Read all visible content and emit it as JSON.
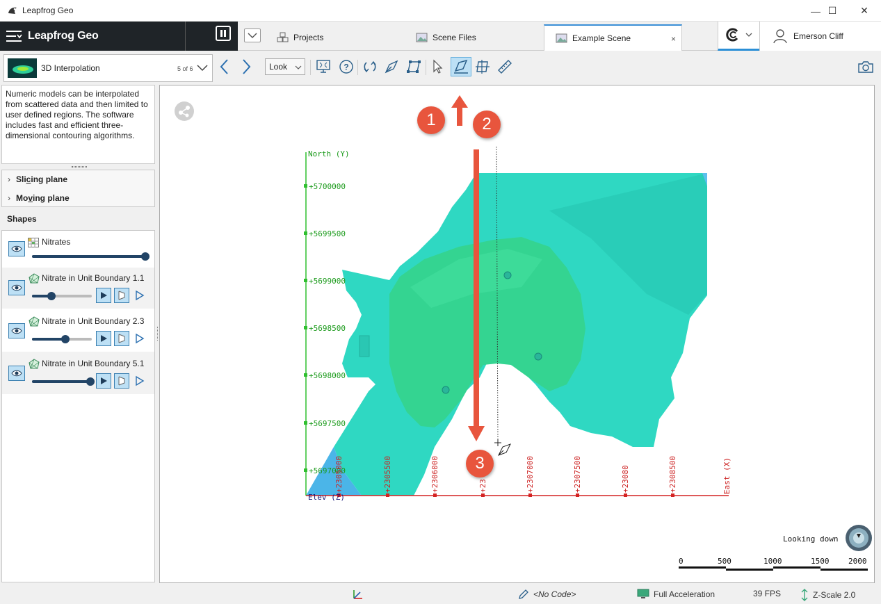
{
  "window": {
    "title": "Leapfrog Geo",
    "minimize": "—",
    "maximize": "☐",
    "close": "✕"
  },
  "header": {
    "brand": "Leapfrog Geo",
    "tabs": [
      {
        "label": "Projects"
      },
      {
        "label": "Scene Files"
      },
      {
        "label": "Example Scene",
        "close": "×"
      }
    ],
    "user": "Emerson Cliff"
  },
  "toolbar": {
    "scene_name": "3D Interpolation",
    "scene_count": "5 of 6",
    "look_label": "Look"
  },
  "description": "Numeric models can be interpolated from scattered data and then limited to user defined regions. The software includes fast and efficient three-dimensional contouring algorithms.",
  "planes": [
    {
      "label_pre": "Sli",
      "label_ul": "c",
      "label_post": "ing plane"
    },
    {
      "label_pre": "Mo",
      "label_ul": "v",
      "label_post": "ing plane"
    }
  ],
  "shapes_heading": "Shapes",
  "shapes": [
    {
      "name": "Nitrates",
      "level": 1.0
    },
    {
      "name": "Nitrate in Unit Boundary 1.1",
      "level": 0.3
    },
    {
      "name": "Nitrate in Unit Boundary 2.3",
      "level": 0.55
    },
    {
      "name": "Nitrate in Unit Boundary 5.1",
      "level": 0.98
    }
  ],
  "viewport": {
    "north_label": "North (Y)",
    "east_label": "East (X)",
    "elev_label": "Elev (Z)",
    "north_ticks": [
      "+5700000",
      "+5699500",
      "+5699000",
      "+5698500",
      "+5698000",
      "+5697500",
      "+5697000"
    ],
    "east_ticks": [
      "+2305000",
      "+2305500",
      "+2306000",
      "+23",
      "+2307000",
      "+2307500",
      "+23080",
      "+2308500"
    ],
    "looking": "Looking down",
    "scale": [
      "0",
      "500",
      "1000",
      "1500",
      "2000"
    ],
    "callouts": [
      "1",
      "2",
      "3"
    ]
  },
  "status": {
    "code": "<No Code>",
    "acceleration": "Full Acceleration",
    "fps": "39 FPS",
    "zscale": "Z-Scale 2.0"
  },
  "colors": {
    "callout": "#e8553d",
    "north_axis": "#1a9a1a",
    "east_axis": "#cc1f1f",
    "dark_header": "#1f2428",
    "highlight": "#bde0f5"
  }
}
